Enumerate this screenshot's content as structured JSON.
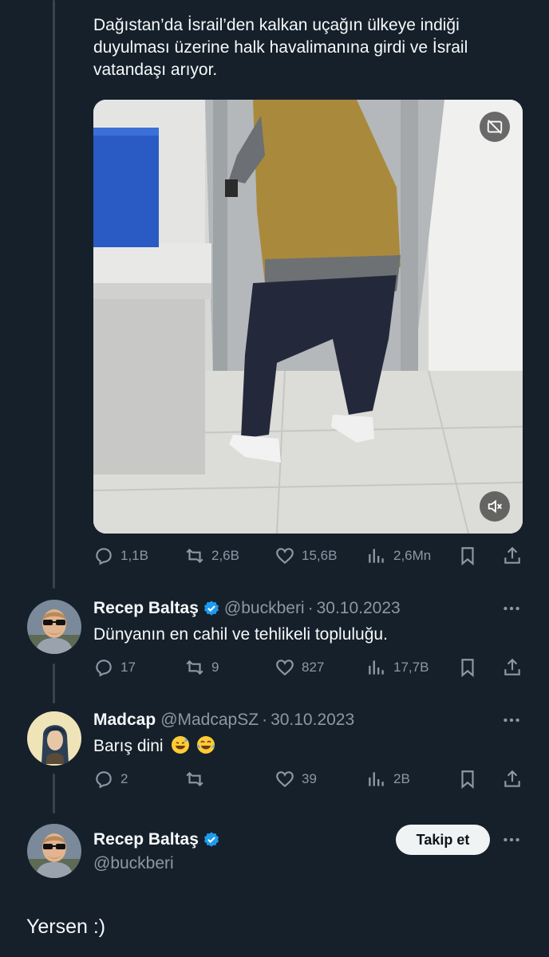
{
  "tweet": {
    "text_line1": "Dağıstan’da İsrail’den kalkan uçağın ülkeye indiği",
    "text_line2": "duyulması üzerine halk havalimanına girdi ve İsrail",
    "text_line3": "vatandaşı arıyor.",
    "stats": {
      "replies": "1,1B",
      "retweets": "2,6B",
      "likes": "15,6B",
      "views": "2,6Mn"
    }
  },
  "reply1": {
    "name": "Recep Baltaş",
    "handle": "@buckberi",
    "separator": "·",
    "date": "30.10.2023",
    "text": "Dünyanın en cahil ve tehlikeli topluluğu.",
    "stats": {
      "replies": "17",
      "retweets": "9",
      "likes": "827",
      "views": "17,7B"
    }
  },
  "reply2": {
    "name": "Madcap",
    "handle": "@MadcapSZ",
    "separator": "·",
    "date": "30.10.2023",
    "text": "Barış dini",
    "stats": {
      "replies": "2",
      "retweets": "",
      "likes": "39",
      "views": "2B"
    }
  },
  "main": {
    "name": "Recep Baltaş",
    "handle": "@buckberi",
    "follow_label": "Takip et",
    "text": "Yersen :)"
  },
  "colors": {
    "background": "#15202b",
    "muted": "#8b98a5",
    "verified": "#1d9bf0",
    "thread_line": "#38444d"
  }
}
